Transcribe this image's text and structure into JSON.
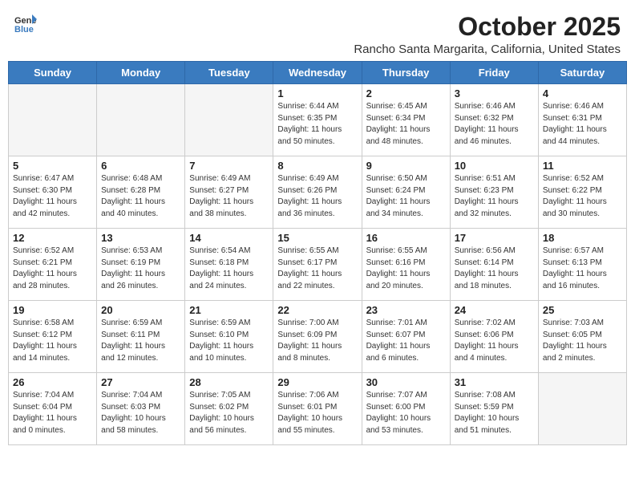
{
  "logo": {
    "text_general": "General",
    "text_blue": "Blue"
  },
  "title": {
    "month": "October 2025",
    "location": "Rancho Santa Margarita, California, United States"
  },
  "headers": [
    "Sunday",
    "Monday",
    "Tuesday",
    "Wednesday",
    "Thursday",
    "Friday",
    "Saturday"
  ],
  "weeks": [
    [
      {
        "day": "",
        "info": ""
      },
      {
        "day": "",
        "info": ""
      },
      {
        "day": "",
        "info": ""
      },
      {
        "day": "1",
        "info": "Sunrise: 6:44 AM\nSunset: 6:35 PM\nDaylight: 11 hours\nand 50 minutes."
      },
      {
        "day": "2",
        "info": "Sunrise: 6:45 AM\nSunset: 6:34 PM\nDaylight: 11 hours\nand 48 minutes."
      },
      {
        "day": "3",
        "info": "Sunrise: 6:46 AM\nSunset: 6:32 PM\nDaylight: 11 hours\nand 46 minutes."
      },
      {
        "day": "4",
        "info": "Sunrise: 6:46 AM\nSunset: 6:31 PM\nDaylight: 11 hours\nand 44 minutes."
      }
    ],
    [
      {
        "day": "5",
        "info": "Sunrise: 6:47 AM\nSunset: 6:30 PM\nDaylight: 11 hours\nand 42 minutes."
      },
      {
        "day": "6",
        "info": "Sunrise: 6:48 AM\nSunset: 6:28 PM\nDaylight: 11 hours\nand 40 minutes."
      },
      {
        "day": "7",
        "info": "Sunrise: 6:49 AM\nSunset: 6:27 PM\nDaylight: 11 hours\nand 38 minutes."
      },
      {
        "day": "8",
        "info": "Sunrise: 6:49 AM\nSunset: 6:26 PM\nDaylight: 11 hours\nand 36 minutes."
      },
      {
        "day": "9",
        "info": "Sunrise: 6:50 AM\nSunset: 6:24 PM\nDaylight: 11 hours\nand 34 minutes."
      },
      {
        "day": "10",
        "info": "Sunrise: 6:51 AM\nSunset: 6:23 PM\nDaylight: 11 hours\nand 32 minutes."
      },
      {
        "day": "11",
        "info": "Sunrise: 6:52 AM\nSunset: 6:22 PM\nDaylight: 11 hours\nand 30 minutes."
      }
    ],
    [
      {
        "day": "12",
        "info": "Sunrise: 6:52 AM\nSunset: 6:21 PM\nDaylight: 11 hours\nand 28 minutes."
      },
      {
        "day": "13",
        "info": "Sunrise: 6:53 AM\nSunset: 6:19 PM\nDaylight: 11 hours\nand 26 minutes."
      },
      {
        "day": "14",
        "info": "Sunrise: 6:54 AM\nSunset: 6:18 PM\nDaylight: 11 hours\nand 24 minutes."
      },
      {
        "day": "15",
        "info": "Sunrise: 6:55 AM\nSunset: 6:17 PM\nDaylight: 11 hours\nand 22 minutes."
      },
      {
        "day": "16",
        "info": "Sunrise: 6:55 AM\nSunset: 6:16 PM\nDaylight: 11 hours\nand 20 minutes."
      },
      {
        "day": "17",
        "info": "Sunrise: 6:56 AM\nSunset: 6:14 PM\nDaylight: 11 hours\nand 18 minutes."
      },
      {
        "day": "18",
        "info": "Sunrise: 6:57 AM\nSunset: 6:13 PM\nDaylight: 11 hours\nand 16 minutes."
      }
    ],
    [
      {
        "day": "19",
        "info": "Sunrise: 6:58 AM\nSunset: 6:12 PM\nDaylight: 11 hours\nand 14 minutes."
      },
      {
        "day": "20",
        "info": "Sunrise: 6:59 AM\nSunset: 6:11 PM\nDaylight: 11 hours\nand 12 minutes."
      },
      {
        "day": "21",
        "info": "Sunrise: 6:59 AM\nSunset: 6:10 PM\nDaylight: 11 hours\nand 10 minutes."
      },
      {
        "day": "22",
        "info": "Sunrise: 7:00 AM\nSunset: 6:09 PM\nDaylight: 11 hours\nand 8 minutes."
      },
      {
        "day": "23",
        "info": "Sunrise: 7:01 AM\nSunset: 6:07 PM\nDaylight: 11 hours\nand 6 minutes."
      },
      {
        "day": "24",
        "info": "Sunrise: 7:02 AM\nSunset: 6:06 PM\nDaylight: 11 hours\nand 4 minutes."
      },
      {
        "day": "25",
        "info": "Sunrise: 7:03 AM\nSunset: 6:05 PM\nDaylight: 11 hours\nand 2 minutes."
      }
    ],
    [
      {
        "day": "26",
        "info": "Sunrise: 7:04 AM\nSunset: 6:04 PM\nDaylight: 11 hours\nand 0 minutes."
      },
      {
        "day": "27",
        "info": "Sunrise: 7:04 AM\nSunset: 6:03 PM\nDaylight: 10 hours\nand 58 minutes."
      },
      {
        "day": "28",
        "info": "Sunrise: 7:05 AM\nSunset: 6:02 PM\nDaylight: 10 hours\nand 56 minutes."
      },
      {
        "day": "29",
        "info": "Sunrise: 7:06 AM\nSunset: 6:01 PM\nDaylight: 10 hours\nand 55 minutes."
      },
      {
        "day": "30",
        "info": "Sunrise: 7:07 AM\nSunset: 6:00 PM\nDaylight: 10 hours\nand 53 minutes."
      },
      {
        "day": "31",
        "info": "Sunrise: 7:08 AM\nSunset: 5:59 PM\nDaylight: 10 hours\nand 51 minutes."
      },
      {
        "day": "",
        "info": ""
      }
    ]
  ]
}
